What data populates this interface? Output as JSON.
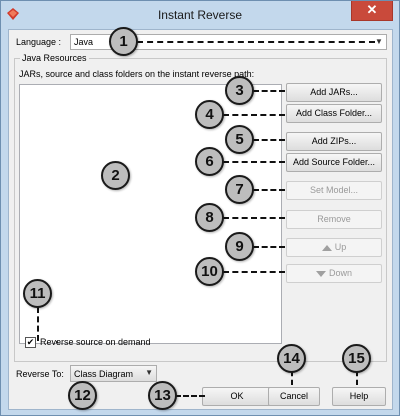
{
  "window": {
    "title": "Instant Reverse",
    "close_label": "✕"
  },
  "language": {
    "label": "Language :",
    "value": "Java"
  },
  "java_resources": {
    "title": "Java Resources",
    "path_label": "JARs, source and class folders on the instant reverse path:"
  },
  "buttons": {
    "add_jars": "Add JARs...",
    "add_class_folder": "Add Class Folder...",
    "add_zips": "Add ZIPs...",
    "add_source_folder": "Add Source Folder...",
    "set_model": "Set Model...",
    "remove": "Remove",
    "up": "Up",
    "down": "Down",
    "ok": "OK",
    "cancel": "Cancel",
    "help": "Help"
  },
  "reverse_on_demand": {
    "label": "Reverse source on demand",
    "checked": true,
    "mark": "✔"
  },
  "reverse_to": {
    "label": "Reverse To:",
    "value": "Class Diagram"
  },
  "callouts": [
    "1",
    "2",
    "3",
    "4",
    "5",
    "6",
    "7",
    "8",
    "9",
    "10",
    "11",
    "12",
    "13",
    "14",
    "15"
  ],
  "colors": {
    "title_bar": "#c3d8ec",
    "close_button": "#c94a3b",
    "callout_fill": "#bdbdbd",
    "dialog_bg": "#f0f0f0"
  }
}
